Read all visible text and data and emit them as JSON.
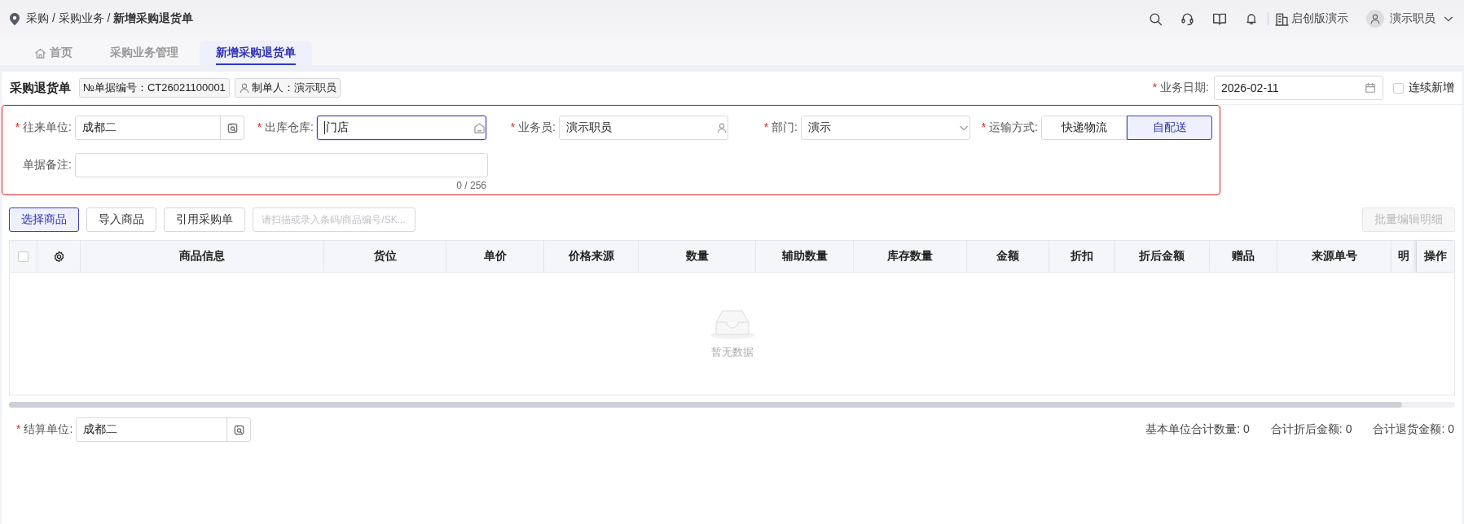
{
  "breadcrumb": "采购 / 采购业务 / **新增采购退货单**",
  "org": "启创版演示",
  "user": "演示职员",
  "tabs": [
    {
      "label": "首页",
      "kind": "home",
      "selected": false
    },
    {
      "label": "采购业务管理",
      "kind": "page",
      "selected": false
    },
    {
      "label": "新增采购退货单",
      "kind": "page",
      "selected": true
    }
  ],
  "header": {
    "title": "采购退货单",
    "doc_number": {
      "label": "№单据编号：",
      "value": "CT26021100001"
    },
    "maker": {
      "label": "制单人：",
      "value": "演示职员"
    },
    "date": {
      "mark": "*",
      "label": "业务日期:",
      "value": "2026-02-11"
    },
    "continuous": {
      "label": "连续新增",
      "checked": false
    }
  },
  "fields": [
    {
      "mark": "*",
      "label": "往来单位:",
      "value": "成都二",
      "kind": "lookup",
      "focused": false
    },
    {
      "mark": "*",
      "label": "出库仓库:",
      "value": "门店",
      "kind": "warehouse",
      "focused": true
    },
    {
      "mark": "*",
      "label": "业务员:",
      "value": "演示职员",
      "kind": "person",
      "focused": false
    },
    {
      "mark": "*",
      "label": "部门:",
      "value": "演示",
      "kind": "select",
      "focused": false
    },
    {
      "mark": "*",
      "label": "运输方式:",
      "kind": "segmented",
      "options": [
        {
          "label": "快递物流",
          "selected": false
        },
        {
          "label": "自配送",
          "selected": true
        }
      ]
    }
  ],
  "remark": {
    "label": "单据备注:",
    "counter": "0 / 256"
  },
  "toolbar": {
    "buttons": [
      {
        "label": "选择商品",
        "kind": "primary"
      },
      {
        "label": "导入商品",
        "kind": "default"
      },
      {
        "label": "引用采购单",
        "kind": "default"
      }
    ],
    "scan_placeholder": "请扫描或录入条码/商品编号/SK...",
    "batch": {
      "label": "批量编辑明细",
      "disabled": true
    }
  },
  "table": {
    "select_all": {
      "checked": false
    },
    "columns": [
      "商品信息",
      "货位",
      "单价",
      "价格来源",
      "数量",
      "辅助数量",
      "库存数量",
      "金额",
      "折扣",
      "折后金额",
      "赠品",
      "来源单号",
      "明",
      "操作"
    ],
    "empty_text": "暂无数据"
  },
  "footer": {
    "settlement": {
      "mark": "*",
      "label": "结算单位:",
      "value": "成都二"
    },
    "totals": [
      {
        "label": "基本单位合计数量:",
        "value": "0"
      },
      {
        "label": "合计折后金额:",
        "value": "0"
      },
      {
        "label": "合计退货金额:",
        "value": "0"
      }
    ]
  }
}
